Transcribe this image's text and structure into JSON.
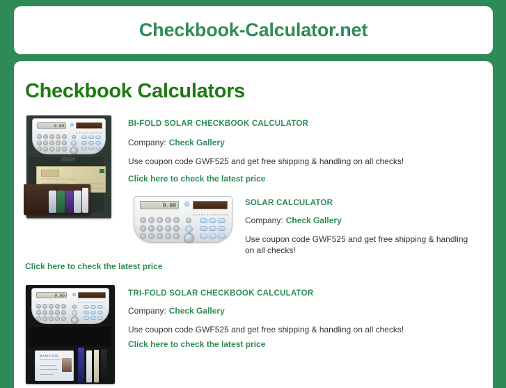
{
  "site": {
    "title": "Checkbook-Calculator.net"
  },
  "main": {
    "heading": "Checkbook Calculators"
  },
  "labels": {
    "company_label": "Company:"
  },
  "colors": {
    "background_green": "#2e8b57",
    "heading_green": "#1d7a12",
    "link_green": "#2e8b57",
    "body_text": "#333333",
    "panel_white": "#ffffff"
  },
  "products": [
    {
      "title": "BI-FOLD SOLAR CHECKBOOK CALCULATOR",
      "company_label": "Company:",
      "company": "Check Gallery",
      "coupon": "Use coupon code GWF525 and get free shipping & handling on all checks!",
      "link": "Click here to check the latest price",
      "image_alt": "bi-fold-checkbook-calculator-photo",
      "calculator_display": "0.00"
    },
    {
      "title": "SOLAR CALCULATOR",
      "company_label": "Company:",
      "company": "Check Gallery",
      "coupon": "Use coupon code GWF525 and get free shipping & handling on all checks!",
      "link": "Click here to check the latest price",
      "image_alt": "solar-calculator-photo",
      "calculator_display": "0.00"
    },
    {
      "title": "TRI-FOLD SOLAR CHECKBOOK CALCULATOR",
      "company_label": "Company:",
      "company": "Check Gallery",
      "coupon": "Use coupon code GWF525 and get free shipping & handling on all checks!",
      "link": "Click here to check the latest price",
      "image_alt": "tri-fold-checkbook-calculator-photo",
      "calculator_display": "0.00",
      "id_card_state": "MARYLAND"
    }
  ]
}
